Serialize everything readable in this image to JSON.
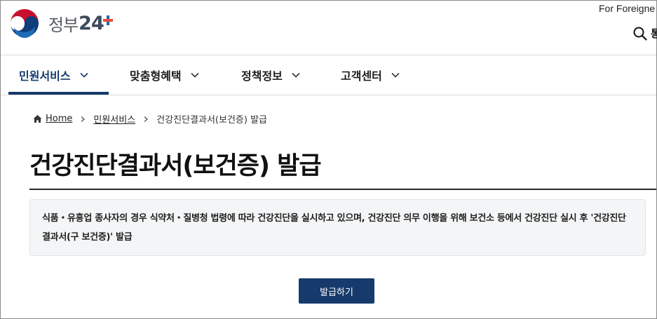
{
  "header": {
    "logo_text": "정부",
    "logo_number": "24",
    "logo_plus": "+",
    "foreign_link": "For Foreigne",
    "search_label": "통"
  },
  "nav": {
    "items": [
      {
        "label": "민원서비스",
        "active": true
      },
      {
        "label": "맞춤형혜택",
        "active": false
      },
      {
        "label": "정책정보",
        "active": false
      },
      {
        "label": "고객센터",
        "active": false
      }
    ]
  },
  "breadcrumb": {
    "home": "Home",
    "level1": "민원서비스",
    "current": "건강진단결과서(보건증) 발급"
  },
  "page": {
    "title": "건강진단결과서(보건증) 발급",
    "description": "식품・유흥업 종사자의 경우 식약처・질병청 법령에 따라 건강진단을 실시하고 있으며, 건강진단 의무 이행을 위해 보건소 등에서 건강진단 실시 후 '건강진단결과서(구 보건증)' 발급",
    "issue_button": "발급하기"
  },
  "colors": {
    "primary": "#153a6b",
    "info_bg": "#f4f5f6"
  },
  "icons": [
    "government-emblem-icon",
    "search-icon",
    "chevron-down-icon",
    "home-icon",
    "chevron-right-icon"
  ]
}
